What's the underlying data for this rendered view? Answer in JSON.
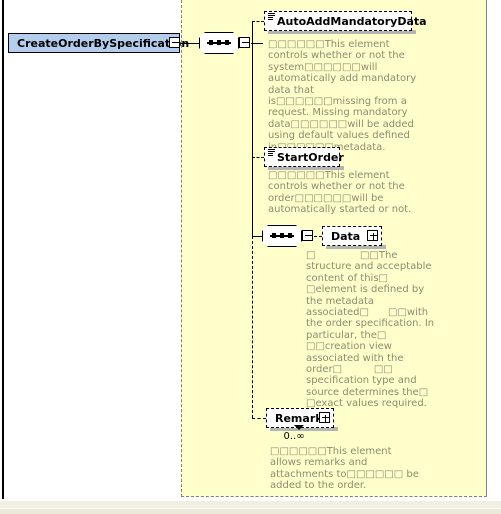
{
  "diagram": {
    "type": "xsd-schema-diagram",
    "root": {
      "name": "CreateOrderBySpecification",
      "collapse_state": "-"
    },
    "colors": {
      "root_fill": "#b4cdec",
      "panel_fill": "#ffffcc",
      "doc_text": "#8c8c70",
      "border": "#000000",
      "shadow": "#b5b5b5"
    },
    "compositors": [
      {
        "kind": "sequence",
        "label": "sequence",
        "collapse_state": "-"
      },
      {
        "kind": "sequence",
        "label": "sequence",
        "collapse_state": "-"
      }
    ],
    "elements": [
      {
        "name": "AutoAddMandatoryData",
        "expander": "none",
        "occurrence": "",
        "documentation": "□□□□□□This element controls whether or not the system□□□□□□will automatically add mandatory data that is□□□□□□missing from a request. Missing mandatory data□□□□□□will be added using default values defined in□□□□□□metadata."
      },
      {
        "name": "StartOrder",
        "expander": "none",
        "occurrence": "",
        "documentation": "□□□□□□This element controls whether or not the order□□□□□□will be automatically started or not."
      },
      {
        "name": "Data",
        "expander": "+",
        "occurrence": "",
        "documentation": "□              □□The structure and acceptable content of this□ □element is defined by the metadata associated□      □□with the order specification. In particular, the□            □□creation view associated with the order□          □□ specification type and source determines the□ □exact values required."
      },
      {
        "name": "Remark",
        "expander": "+",
        "occurrence": "0..∞",
        "documentation": "□□□□□□This element allows remarks and attachments to□□□□□□ be added to the order."
      }
    ]
  }
}
